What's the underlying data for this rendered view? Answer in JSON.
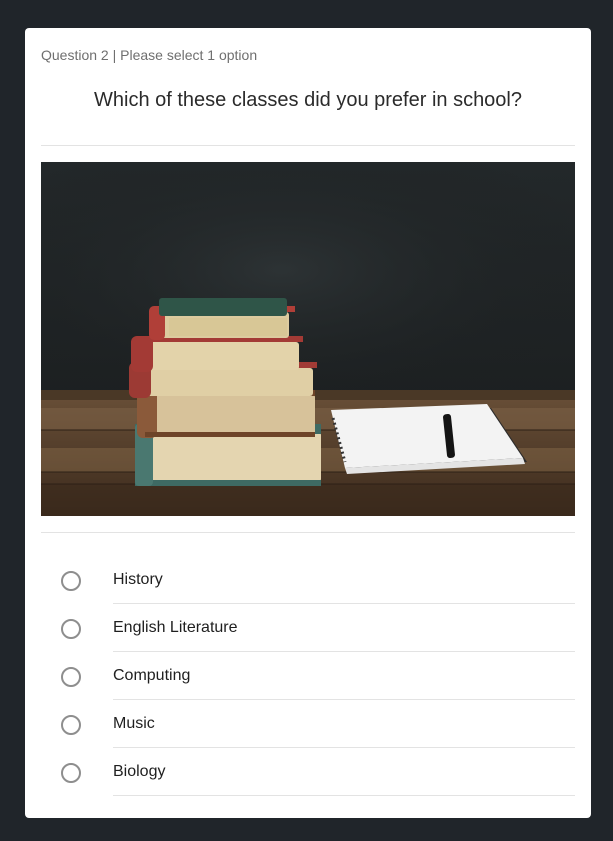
{
  "question": {
    "meta": "Question 2 | Please select 1 option",
    "text": "Which of these classes did you prefer in school?"
  },
  "image": {
    "subject": "stack-of-books-and-notebook-photo"
  },
  "options": [
    {
      "label": "History",
      "selected": false
    },
    {
      "label": "English Literature",
      "selected": false
    },
    {
      "label": "Computing",
      "selected": false
    },
    {
      "label": "Music",
      "selected": false
    },
    {
      "label": "Biology",
      "selected": false
    }
  ],
  "colors": {
    "page_background": "#20252a",
    "card_background": "#ffffff",
    "divider": "#e3e3e3",
    "radio_border": "#8e8e8e"
  }
}
